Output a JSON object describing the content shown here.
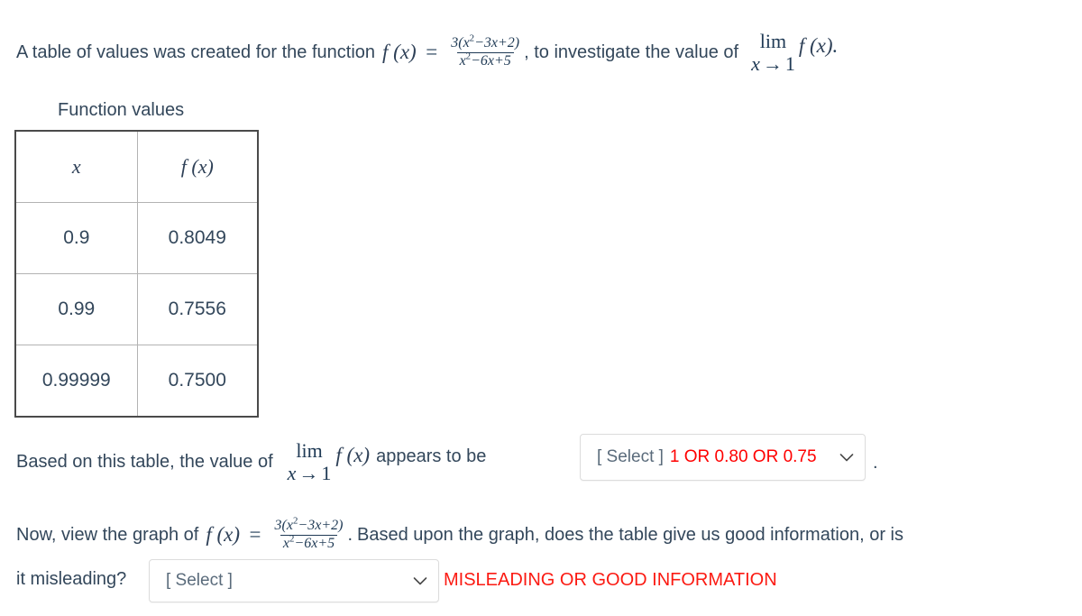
{
  "intro": {
    "text_before": "A table of values was created for the function",
    "fx_label": "f (x)",
    "equals": "=",
    "fraction": {
      "numerator_pre": "3(x",
      "numerator_exp": "2",
      "numerator_post": "−3x+2)",
      "denominator_pre": "x",
      "denominator_exp": "2",
      "denominator_post": "−6x+5"
    },
    "text_middle": ", to investigate the value of",
    "limit": {
      "lim": "lim",
      "var": "x",
      "arrow": "→",
      "target": "1"
    },
    "limit_fx": "f (x)",
    "period": "."
  },
  "table": {
    "caption": "Function values",
    "headers": [
      "x",
      "f (x)"
    ],
    "rows": [
      {
        "x": "0.9",
        "fx": "0.8049"
      },
      {
        "x": "0.99",
        "fx": "0.7556"
      },
      {
        "x": "0.99999",
        "fx": "0.7500"
      }
    ]
  },
  "question1": {
    "text_before": "Based on this table, the value of",
    "limit": {
      "lim": "lim",
      "var": "x",
      "arrow": "→",
      "target": "1"
    },
    "limit_fx": "f (x)",
    "text_after": "appears to be",
    "dropdown": {
      "placeholder": "[ Select ]",
      "value": "1 OR 0.80 OR 0.75",
      "chevron": "chevron-down-icon",
      "options": [
        "1",
        "0.80",
        "0.75"
      ]
    },
    "period": "."
  },
  "question2": {
    "text_before": "Now, view the graph of",
    "fx_label": "f (x)",
    "equals": "=",
    "fraction": {
      "numerator_pre": "3(x",
      "numerator_exp": "2",
      "numerator_post": "−3x+2)",
      "denominator_pre": "x",
      "denominator_exp": "2",
      "denominator_post": "−6x+5"
    },
    "period_after_fraction": ".",
    "text_after": "Based upon the graph, does the table give us good information, or is",
    "text_line2": "it misleading?",
    "dropdown": {
      "placeholder": "[ Select ]",
      "value": "",
      "chevron": "chevron-down-icon",
      "options": [
        "MISLEADING",
        "GOOD INFORMATION"
      ]
    },
    "red_label": "MISLEADING OR GOOD INFORMATION"
  },
  "colors": {
    "text": "#33475b",
    "math": "#1f3a55",
    "red": "#fb1a12",
    "dropdown_red": "#ff0000",
    "table_outer_border": "#4a4a4a",
    "table_inner_border": "#b3b3b3",
    "dropdown_border": "#dcdcdc"
  }
}
